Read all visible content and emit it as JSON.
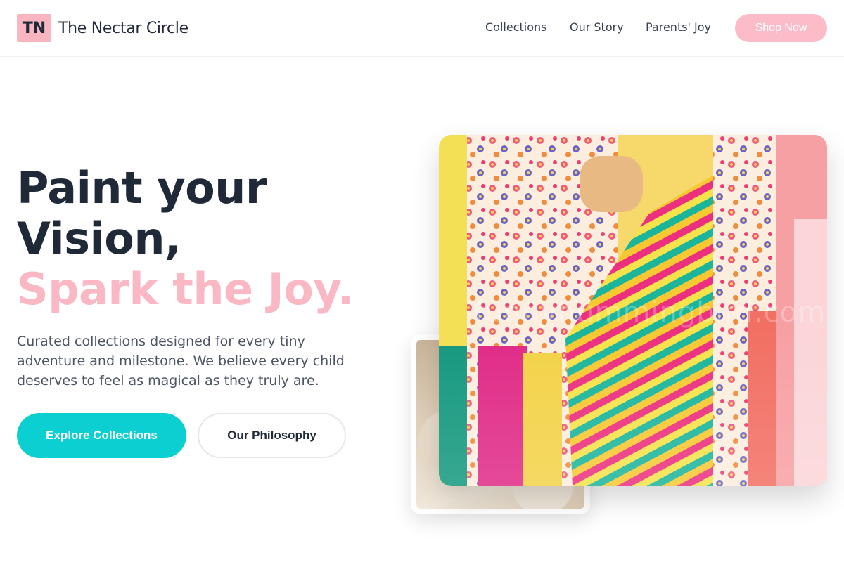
{
  "header": {
    "logo_mark": "TN",
    "brand_name": "The Nectar Circle",
    "nav": {
      "collections": "Collections",
      "our_story": "Our Story",
      "parents_joy": "Parents' Joy"
    },
    "shop_now": "Shop Now"
  },
  "hero": {
    "headline_line1": "Paint your",
    "headline_line2": "Vision,",
    "headline_accent": "Spark the Joy.",
    "description": "Curated collections designed for every tiny adventure and milestone. We believe every child deserves to feel as magical as they truly are.",
    "primary_cta": "Explore Collections",
    "secondary_cta": "Our Philosophy"
  },
  "images": {
    "watermark": "funnyhummingbird.com"
  },
  "colors": {
    "brand_pink": "#f9b6c0",
    "accent_pink": "#f9b8c3",
    "primary_teal": "#0ccfd1",
    "text_dark": "#1f2937",
    "text_body": "#4b5563"
  }
}
